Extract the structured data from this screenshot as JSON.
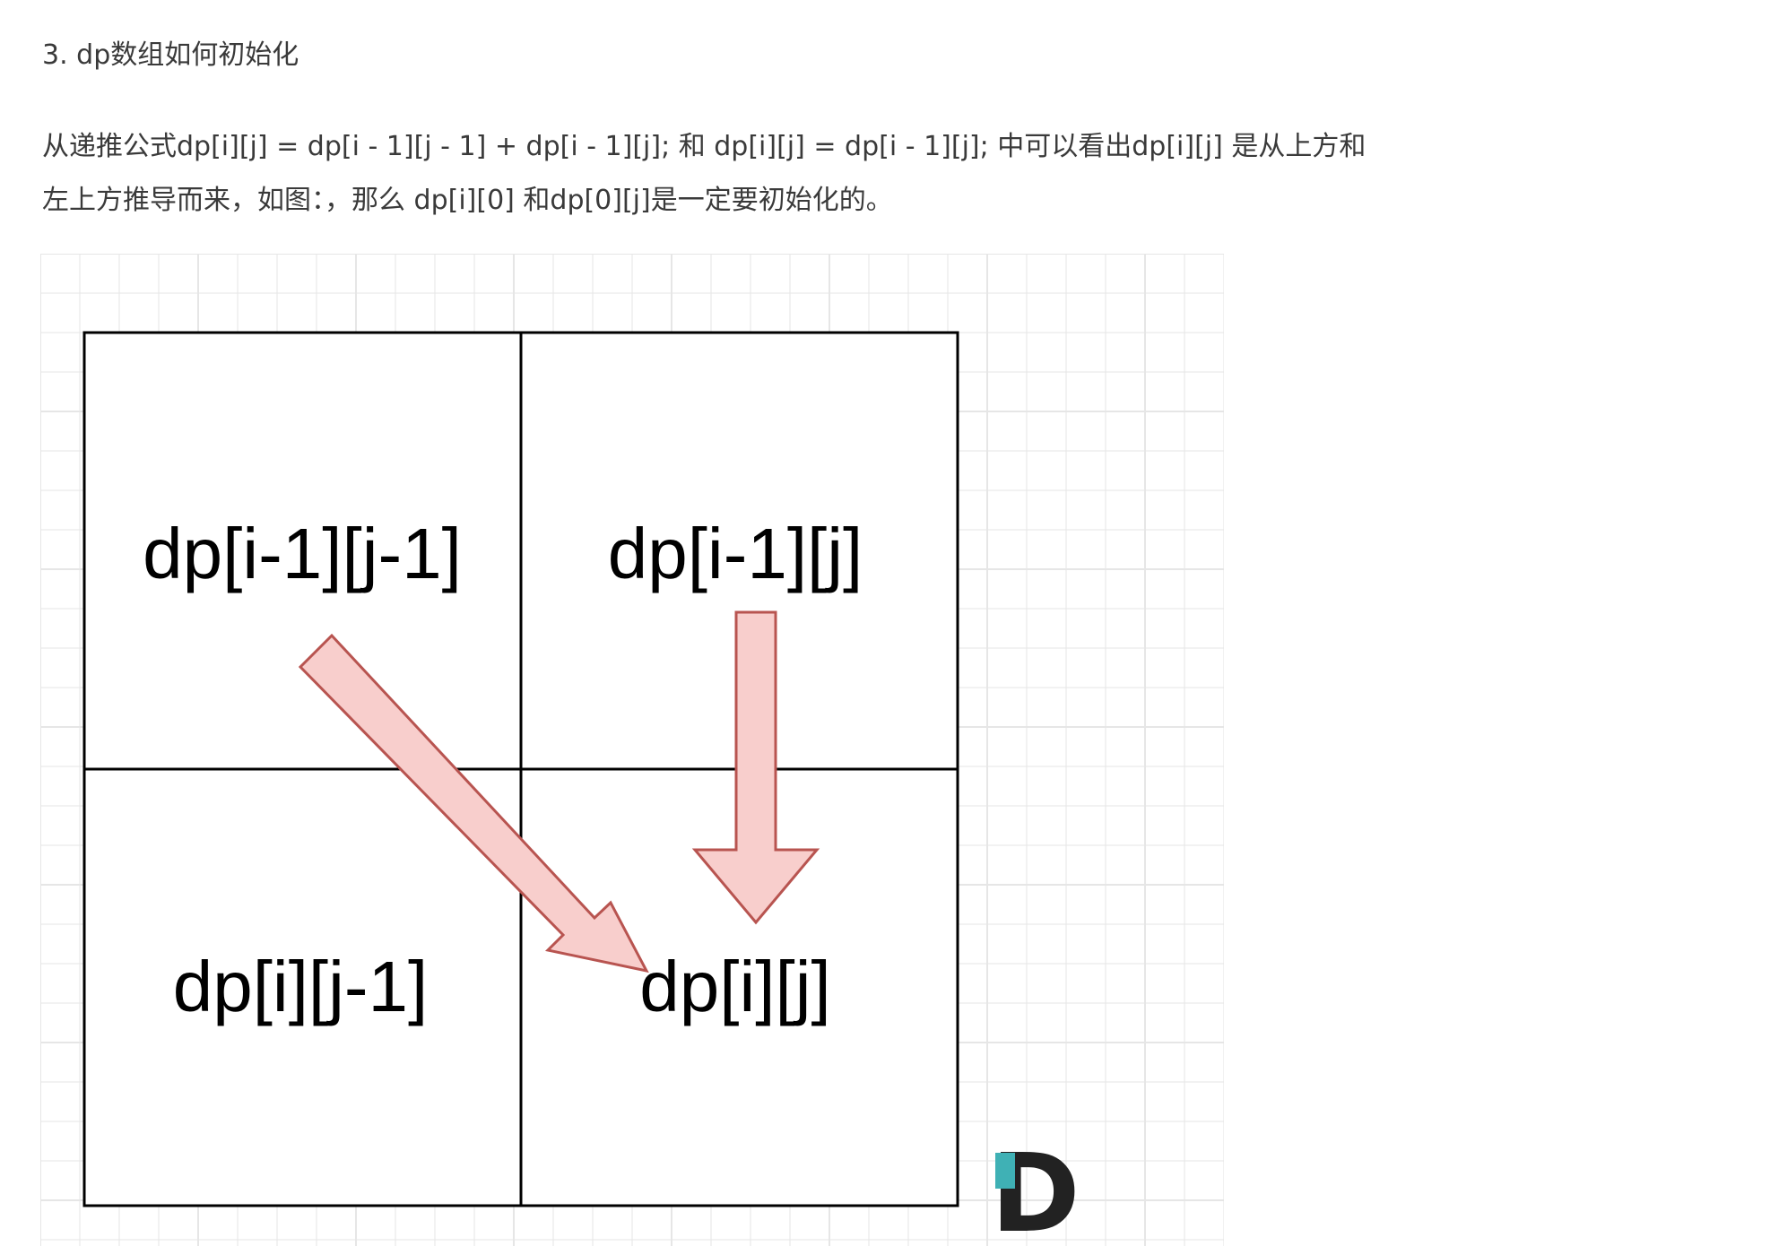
{
  "heading": "3. dp数组如何初始化",
  "paragraph": {
    "line1": "从递推公式dp[i][j] = dp[i - 1][j - 1] + dp[i - 1][j]; 和 dp[i][j] = dp[i - 1][j]; 中可以看出dp[i][j] 是从上方和",
    "line2": "左上方推导而来，如图：，那么 dp[i][0] 和dp[0][j]是一定要初始化的。"
  },
  "diagram": {
    "cells": {
      "top_left": "dp[i-1][j-1]",
      "top_right": "dp[i-1][j]",
      "bottom_left": "dp[i][j-1]",
      "bottom_right": "dp[i][j]"
    },
    "watermark_logo": "D",
    "colors": {
      "arrow_fill": "#f8cecc",
      "arrow_stroke": "#b85450",
      "grid_line": "#e6e6e6",
      "logo_dark": "#222222",
      "logo_accent": "#3fb1b5"
    }
  }
}
